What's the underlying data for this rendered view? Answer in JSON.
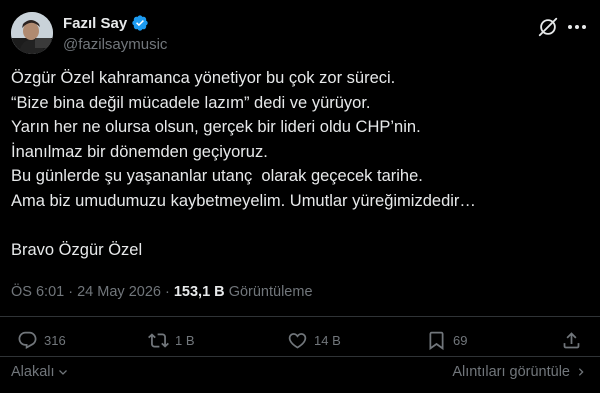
{
  "author": {
    "name": "Fazıl Say",
    "handle": "@fazilsaymusic"
  },
  "tweet": {
    "lines": [
      "Özgür Özel kahramanca yönetiyor bu çok zor süreci.",
      "“Bize bina değil mücadele lazım” dedi ve yürüyor.",
      "Yarın her ne olursa olsun, gerçek bir lideri oldu CHP’nin.",
      "İnanılmaz bir dönemden geçiyoruz.",
      "Bu günlerde şu yaşananlar utanç  olarak geçecek tarihe.",
      "Ama biz umudumuzu kaybetmeyelim. Umutlar yüreğimizdedir…",
      "Bravo Özgür Özel"
    ]
  },
  "meta": {
    "time": "ÖS 6:01",
    "separator": "·",
    "date": "24 May 2026",
    "views": "153,1 B",
    "views_label": "Görüntüleme"
  },
  "actions": {
    "replies": "316",
    "reposts": "1 B",
    "likes": "14 B",
    "bookmarks": "69"
  },
  "footer": {
    "relevant": "Alakalı",
    "quotes": "Alıntıları görüntüle"
  },
  "colors": {
    "background": "#000000",
    "text": "#e7e9ea",
    "muted": "#71767b",
    "verified": "#1d9bf0",
    "divider": "#2f3336"
  }
}
